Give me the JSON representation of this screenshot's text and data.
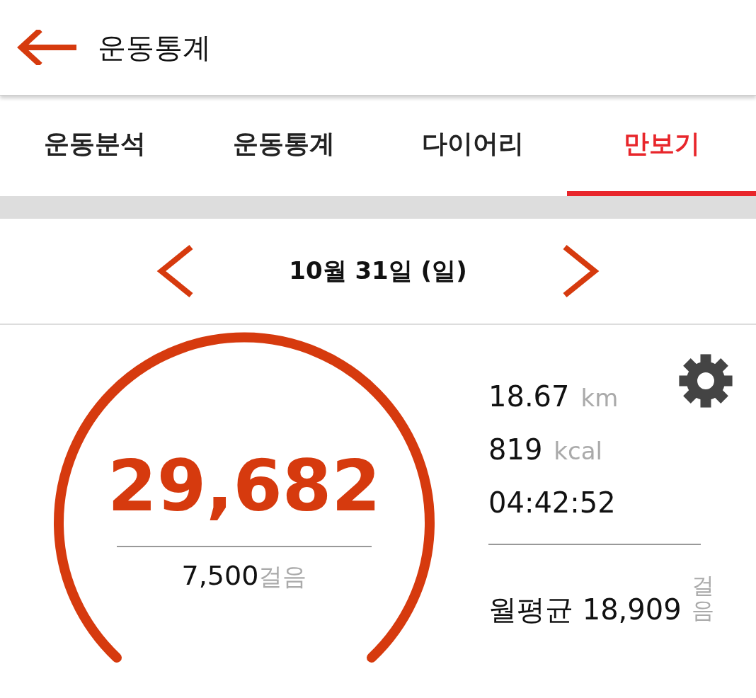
{
  "header": {
    "title": "운동통계"
  },
  "tabs": [
    {
      "label": "운동분석",
      "selected": false
    },
    {
      "label": "운동통계",
      "selected": false
    },
    {
      "label": "다이어리",
      "selected": false
    },
    {
      "label": "만보기",
      "selected": true
    }
  ],
  "date_nav": {
    "date": "10월 31일 (일)"
  },
  "pedometer": {
    "steps": "29,682",
    "goal": "7,500",
    "goal_unit": "걸음",
    "stats": [
      {
        "value": "18.67",
        "unit": "km"
      },
      {
        "value": "819",
        "unit": "kcal"
      },
      {
        "value": "04:42:52"
      }
    ],
    "monthly_avg": {
      "label": "월평균",
      "value": "18,909",
      "unit": "걸음"
    }
  }
}
